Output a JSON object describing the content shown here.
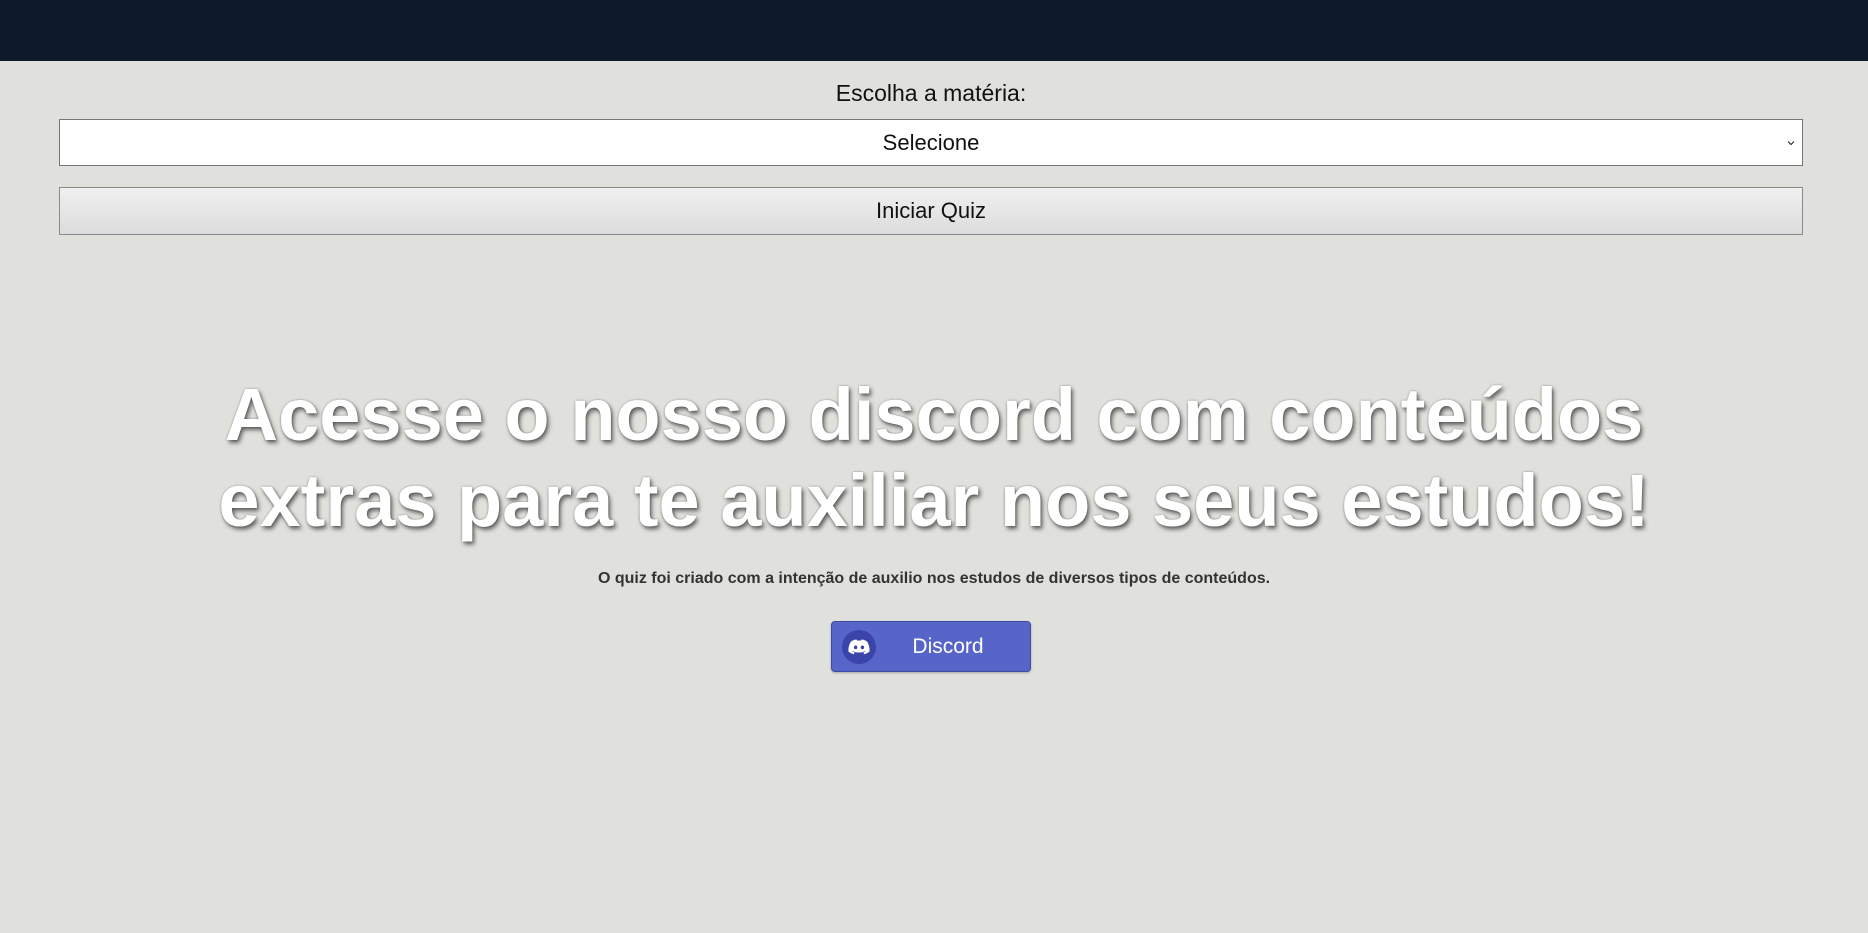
{
  "quiz": {
    "subject_label": "Escolha a matéria:",
    "subject_select": {
      "selected": "Selecione"
    },
    "start_button_label": "Iniciar Quiz"
  },
  "hero": {
    "title_line1": "Acesse o nosso discord com conteúdos",
    "title_line2": "extras para te auxiliar nos seus estudos!",
    "description": "O quiz foi criado com a intenção de auxilio nos estudos de diversos tipos de conteúdos.",
    "discord_button_label": "Discord"
  },
  "icons": {
    "select": "chevron-down-icon",
    "discord": "discord-logo-icon"
  },
  "colors": {
    "topbar": "#0d1a2b",
    "background": "#e0e0dc",
    "discord_button": "#5865c8"
  }
}
